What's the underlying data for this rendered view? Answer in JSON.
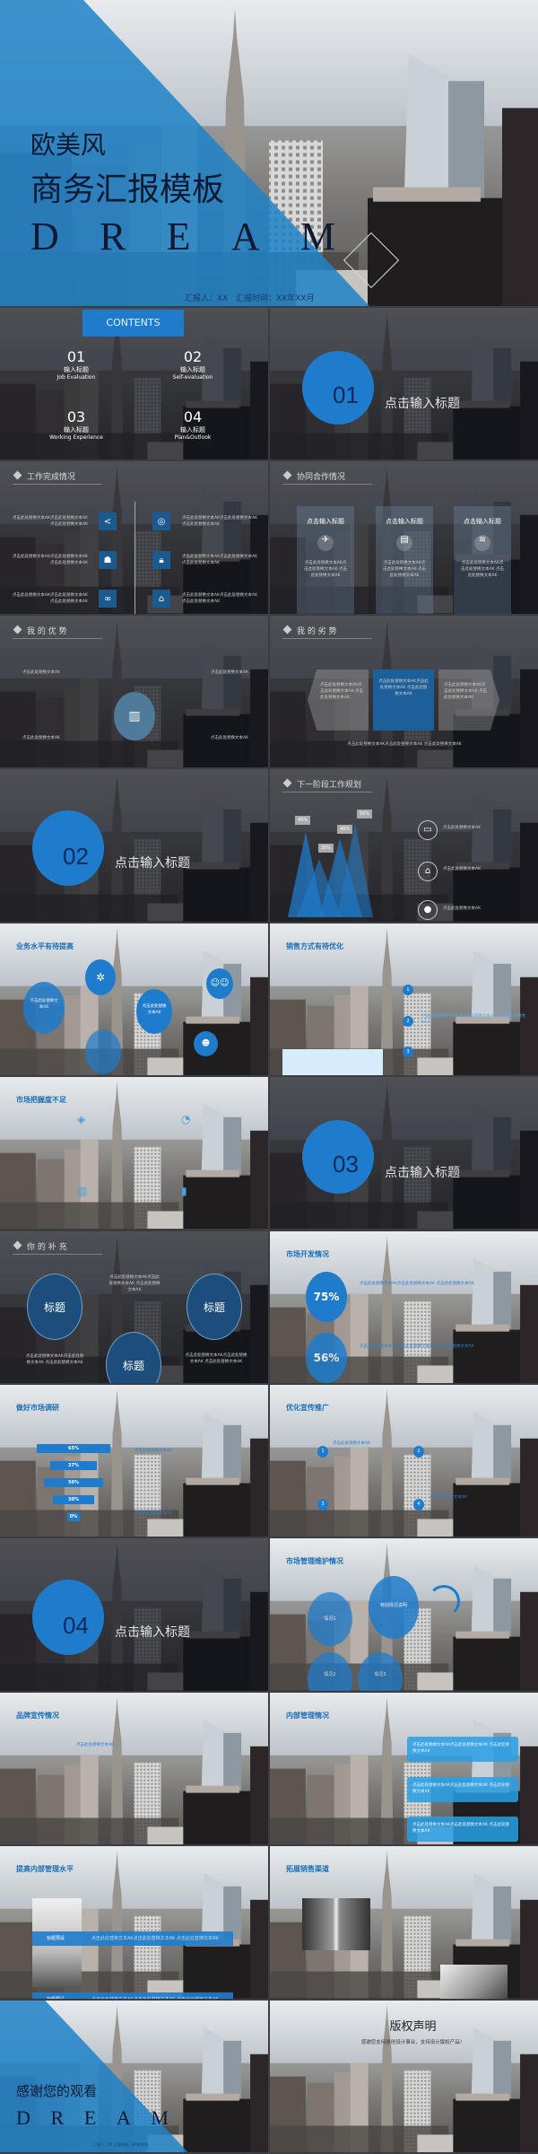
{
  "colors": {
    "accent": "#1f7ccc",
    "dark_overlay": "#14161c",
    "text_dark": "#0e1a33"
  },
  "placeholder": "点击此处替换文本AK点击此处替换文本AK 点击此处替换文本AK",
  "placeholder_short": "点击此处替换文本AK",
  "cover": {
    "line1": "欧美风",
    "line2": "商务汇报模板",
    "dream": [
      "D",
      "R",
      "E",
      "A",
      "M"
    ],
    "reporter": "汇报人：XX",
    "time": "汇报时间：XX年XX月"
  },
  "contents": {
    "title": "CONTENTS",
    "items": [
      {
        "num": "01",
        "title": "输入标题",
        "en": "Job Evaluation"
      },
      {
        "num": "02",
        "title": "输入标题",
        "en": "Self-evaluation"
      },
      {
        "num": "03",
        "title": "输入标题",
        "en": "Working Experience"
      },
      {
        "num": "04",
        "title": "输入标题",
        "en": "Plan&Outlook"
      }
    ]
  },
  "section_title": "点击输入标题",
  "sections": [
    "01",
    "02",
    "03",
    "04"
  ],
  "work": {
    "title": "工作完成情况",
    "icons": [
      "share-icon",
      "target-icon",
      "team-icon",
      "lock-icon",
      "link-icon",
      "home-icon"
    ]
  },
  "coop": {
    "title": "协同合作情况",
    "card_title": "点击输入标题",
    "icons": [
      "plane-icon",
      "calendar-icon",
      "layers-icon"
    ]
  },
  "adv": {
    "title": "我 的 优 势"
  },
  "disadv": {
    "title": "我 的 劣 势"
  },
  "plan": {
    "title": "下一阶段工作规划",
    "peaks": [
      "45%",
      "20%",
      "40%",
      "50%"
    ]
  },
  "biz": {
    "title": "业务水平有待提高"
  },
  "sales": {
    "title": "销售方式有待优化",
    "steps": [
      "1",
      "2",
      "3"
    ]
  },
  "market_grasp": {
    "title": "市场把握度不足"
  },
  "supp": {
    "title": "你 的 补 充",
    "label": "标题"
  },
  "mdev": {
    "title": "市场开发情况",
    "values": [
      "75%",
      "56%"
    ]
  },
  "research": {
    "title": "做好市场调研",
    "bars": [
      "65%",
      "37%",
      "50%",
      "30%",
      "0%"
    ],
    "values": [
      65,
      37,
      50,
      30,
      0
    ]
  },
  "promo": {
    "title": "优化宣传推广",
    "steps": [
      "1",
      "2",
      "3",
      "4"
    ]
  },
  "mmaint": {
    "title": "市场管理维护情况",
    "c1": "情况1",
    "c2": "情况2",
    "c3": "情况3",
    "special": "特别情况说明"
  },
  "brand": {
    "title": "品牌宣传情况"
  },
  "internal": {
    "title": "内部管理情况"
  },
  "improve": {
    "title": "提高内部管理水平",
    "label": "标题预设"
  },
  "channels": {
    "title": "拓展销售渠道"
  },
  "thanks": {
    "line1": "感谢您的观看",
    "reporter": "汇报人：XX   汇报时间：XX年XX月"
  },
  "copyright": {
    "title": "版权声明",
    "subtitle": "感谢您支持原创设计事业，支持设计版权产品！"
  }
}
